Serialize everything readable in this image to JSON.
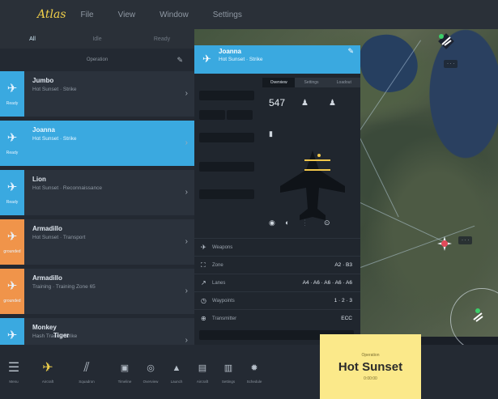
{
  "menu": {
    "logo": "Atlas",
    "items": [
      "File",
      "View",
      "Window",
      "Settings"
    ]
  },
  "sidebar": {
    "filters": [
      "All",
      "Idle",
      "Ready"
    ],
    "sort_label": "Operation",
    "aircraft": [
      {
        "name": "Jumbo",
        "mission": "Hot Sunset · Strike",
        "state": "Ready",
        "side": "blue",
        "glyph": "✈"
      },
      {
        "name": "Joanna",
        "mission": "Hot Sunset · Strike",
        "state": "Ready",
        "side": "blue",
        "glyph": "✈",
        "selected": true
      },
      {
        "name": "Lion",
        "mission": "Hot Sunset · Reconnaissance",
        "state": "Ready",
        "side": "blue",
        "glyph": "✈"
      },
      {
        "name": "Armadillo",
        "mission": "Hot Sunset · Transport",
        "state": "grounded",
        "side": "orange",
        "glyph": "✈"
      },
      {
        "name": "Armadillo",
        "mission": "Training · Training Zone 65",
        "state": "grounded",
        "side": "orange",
        "glyph": "✈"
      },
      {
        "name": "Monkey",
        "mission": "Hash Track · Strike",
        "state": "Ready",
        "side": "blue",
        "glyph": "✈"
      }
    ],
    "partial_item": "Tiger"
  },
  "detail": {
    "title": "Joanna",
    "mission": "Hot Sunset · Strike",
    "tabs": [
      "Overview",
      "Settings",
      "Loadout"
    ],
    "count": "547",
    "rows": [
      {
        "icon": "✈",
        "label": "Weapons",
        "value": ""
      },
      {
        "icon": "⛶",
        "label": "Zone",
        "value": "A2 · B3"
      },
      {
        "icon": "↗",
        "label": "Lanes",
        "value": "A4 · A6 · A6 · A6 · A6"
      },
      {
        "icon": "◷",
        "label": "Waypoints",
        "value": "1 · 2 · 3"
      },
      {
        "icon": "⊕",
        "label": "Transmitter",
        "value": "ECC"
      }
    ]
  },
  "bottom": {
    "buttons": [
      "Menu",
      "Aircraft",
      "Squadron",
      "Timeline",
      "Overview",
      "Launch",
      "Aircraft",
      "Settings",
      "Schedule"
    ],
    "status_title": "Operation",
    "status_name": "Hot Sunset",
    "status_sub": "0:00:00"
  },
  "colors": {
    "accent": "#3aa9e0",
    "grounded": "#f0944a",
    "status": "#fbe98a"
  }
}
